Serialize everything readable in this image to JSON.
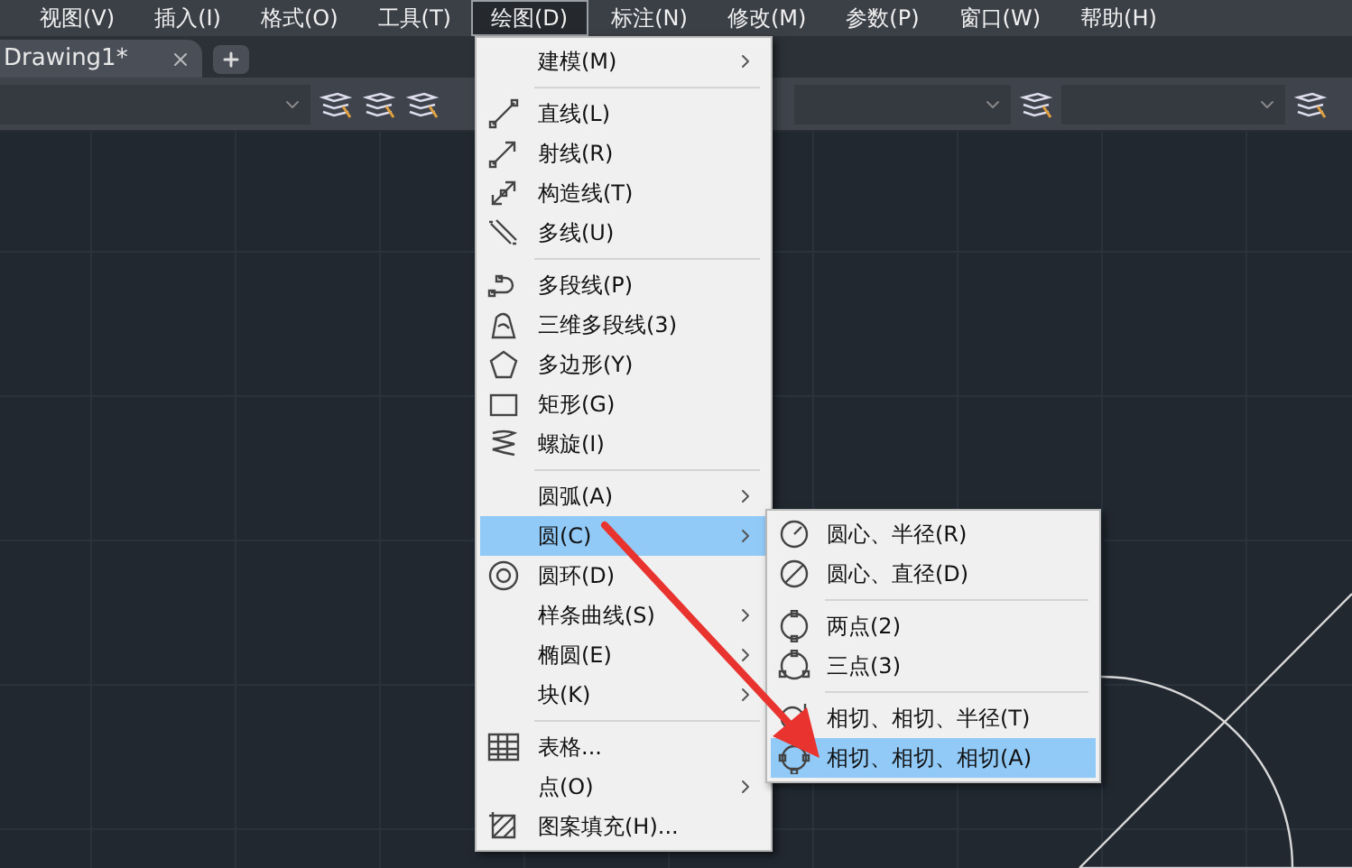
{
  "menu_bar": {
    "items": [
      {
        "label": "视图(V)",
        "selected": false
      },
      {
        "label": "插入(I)",
        "selected": false
      },
      {
        "label": "格式(O)",
        "selected": false
      },
      {
        "label": "工具(T)",
        "selected": false
      },
      {
        "label": "绘图(D)",
        "selected": true
      },
      {
        "label": "标注(N)",
        "selected": false
      },
      {
        "label": "修改(M)",
        "selected": false
      },
      {
        "label": "参数(P)",
        "selected": false
      },
      {
        "label": "窗口(W)",
        "selected": false
      },
      {
        "label": "帮助(H)",
        "selected": false
      }
    ]
  },
  "tabs": [
    {
      "label": "Drawing1*",
      "selected": true
    }
  ],
  "draw_menu": {
    "sections": [
      [
        {
          "label": "建模(M)",
          "kind": "none",
          "submenu": true,
          "selected": false
        }
      ],
      [
        {
          "label": "直线(L)",
          "kind": "line",
          "submenu": false,
          "selected": false
        },
        {
          "label": "射线(R)",
          "kind": "ray",
          "submenu": false,
          "selected": false
        },
        {
          "label": "构造线(T)",
          "kind": "xline",
          "submenu": false,
          "selected": false
        },
        {
          "label": "多线(U)",
          "kind": "mline",
          "submenu": false,
          "selected": false
        }
      ],
      [
        {
          "label": "多段线(P)",
          "kind": "polyline",
          "submenu": false,
          "selected": false
        },
        {
          "label": "三维多段线(3)",
          "kind": "poly3d",
          "submenu": false,
          "selected": false
        },
        {
          "label": "多边形(Y)",
          "kind": "polygon",
          "submenu": false,
          "selected": false
        },
        {
          "label": "矩形(G)",
          "kind": "rectangle",
          "submenu": false,
          "selected": false
        },
        {
          "label": "螺旋(I)",
          "kind": "helix",
          "submenu": false,
          "selected": false
        }
      ],
      [
        {
          "label": "圆弧(A)",
          "kind": "none",
          "submenu": true,
          "selected": false
        },
        {
          "label": "圆(C)",
          "kind": "none",
          "submenu": true,
          "selected": true
        },
        {
          "label": "圆环(D)",
          "kind": "donut",
          "submenu": false,
          "selected": false
        },
        {
          "label": "样条曲线(S)",
          "kind": "none",
          "submenu": true,
          "selected": false
        },
        {
          "label": "椭圆(E)",
          "kind": "none",
          "submenu": true,
          "selected": false
        },
        {
          "label": "块(K)",
          "kind": "none",
          "submenu": true,
          "selected": false
        }
      ],
      [
        {
          "label": "表格...",
          "kind": "table",
          "submenu": false,
          "selected": false
        },
        {
          "label": "点(O)",
          "kind": "none",
          "submenu": true,
          "selected": false
        },
        {
          "label": "图案填充(H)...",
          "kind": "hatch",
          "submenu": false,
          "selected": false
        }
      ]
    ]
  },
  "circle_submenu": {
    "sections": [
      [
        {
          "label": "圆心、半径(R)",
          "kind": "center-radius",
          "selected": false
        },
        {
          "label": "圆心、直径(D)",
          "kind": "center-diameter",
          "selected": false
        }
      ],
      [
        {
          "label": "两点(2)",
          "kind": "two-point",
          "selected": false
        },
        {
          "label": "三点(3)",
          "kind": "three-point",
          "selected": false
        }
      ],
      [
        {
          "label": "相切、相切、半径(T)",
          "kind": "tan-radius",
          "selected": false
        },
        {
          "label": "相切、相切、相切(A)",
          "kind": "tan-tan",
          "selected": true
        }
      ]
    ]
  }
}
